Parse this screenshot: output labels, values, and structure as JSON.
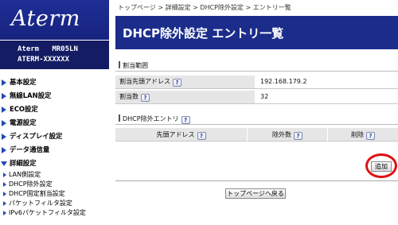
{
  "sidebar": {
    "logo": "Aterm",
    "model_line1": "Aterm   MR05LN",
    "model_line2": "ATERM-XXXXXX",
    "items": [
      {
        "label": "基本設定"
      },
      {
        "label": "無線LAN設定"
      },
      {
        "label": "ECO設定"
      },
      {
        "label": "電源設定"
      },
      {
        "label": "ディスプレイ設定"
      },
      {
        "label": "データ通信量"
      },
      {
        "label": "詳細設定"
      }
    ],
    "sub_items": [
      {
        "label": "LAN側設定"
      },
      {
        "label": "DHCP除外設定"
      },
      {
        "label": "DHCP固定割当設定"
      },
      {
        "label": "パケットフィルタ設定"
      },
      {
        "label": "IPv6パケットフィルタ設定"
      }
    ]
  },
  "breadcrumb": "トップページ > 詳細設定 > DHCP除外設定 > エントリ一覧",
  "page_title": "DHCP除外設定 エントリ一覧",
  "assignment": {
    "section_title": "割当範囲",
    "start_label": "割当先頭アドレス",
    "start_value": "192.168.179.2",
    "count_label": "割当数",
    "count_value": "32"
  },
  "exclusion": {
    "section_title": "DHCP除外エントリ",
    "columns": [
      "先頭アドレス",
      "除外数",
      "削除"
    ]
  },
  "help_glyph": "?",
  "add_button": "追加",
  "back_button": "トップページへ戻る",
  "colors": {
    "accent": "#1b2c8b",
    "highlight": "#e01010"
  }
}
